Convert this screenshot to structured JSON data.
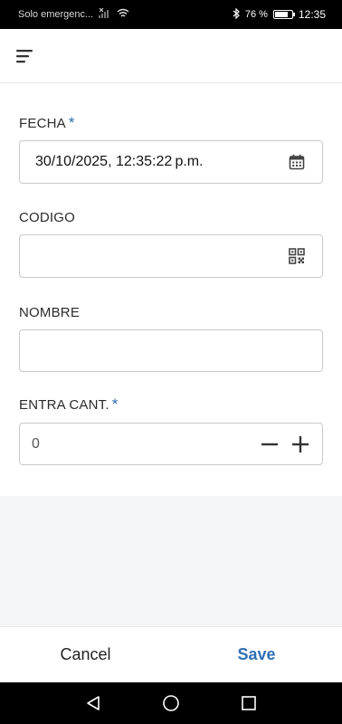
{
  "status_bar": {
    "carrier": "Solo emergenc...",
    "battery_pct": "76 %",
    "battery_level": 0.76,
    "time": "12:35"
  },
  "header": {
    "menu_icon": "menu-icon"
  },
  "form": {
    "fecha": {
      "label": "FECHA",
      "required": "*",
      "value": "30/10/2025, 12:35:22 p.m.",
      "icon": "calendar-icon"
    },
    "codigo": {
      "label": "CODIGO",
      "value": "",
      "icon": "qr-code-icon"
    },
    "nombre": {
      "label": "NOMBRE",
      "value": ""
    },
    "entra_cant": {
      "label": "ENTRA CANT.",
      "required": "*",
      "value": "0",
      "decrement_icon": "minus-icon",
      "increment_icon": "plus-icon"
    }
  },
  "actions": {
    "cancel": "Cancel",
    "save": "Save"
  },
  "nav": {
    "back": "back-icon",
    "home": "home-icon",
    "recents": "recents-icon"
  },
  "colors": {
    "accent": "#2f6db5",
    "required": "#2b6cb0"
  }
}
